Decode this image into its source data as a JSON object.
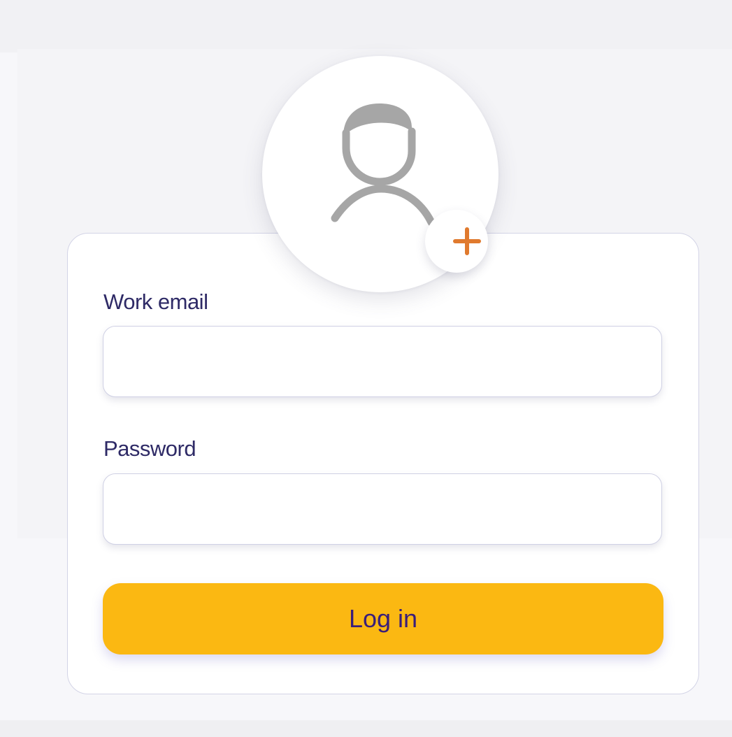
{
  "avatar": {
    "icon": "user-silhouette-icon",
    "add_icon": "plus-icon",
    "add_icon_color": "#e07a2e"
  },
  "form": {
    "email_label": "Work email",
    "email_value": "",
    "password_label": "Password",
    "password_value": "",
    "login_label": "Log in"
  },
  "colors": {
    "label_text": "#2e2a66",
    "button_background": "#fbb812",
    "button_text": "#3a1e7a",
    "card_border": "#d3d4e6"
  }
}
